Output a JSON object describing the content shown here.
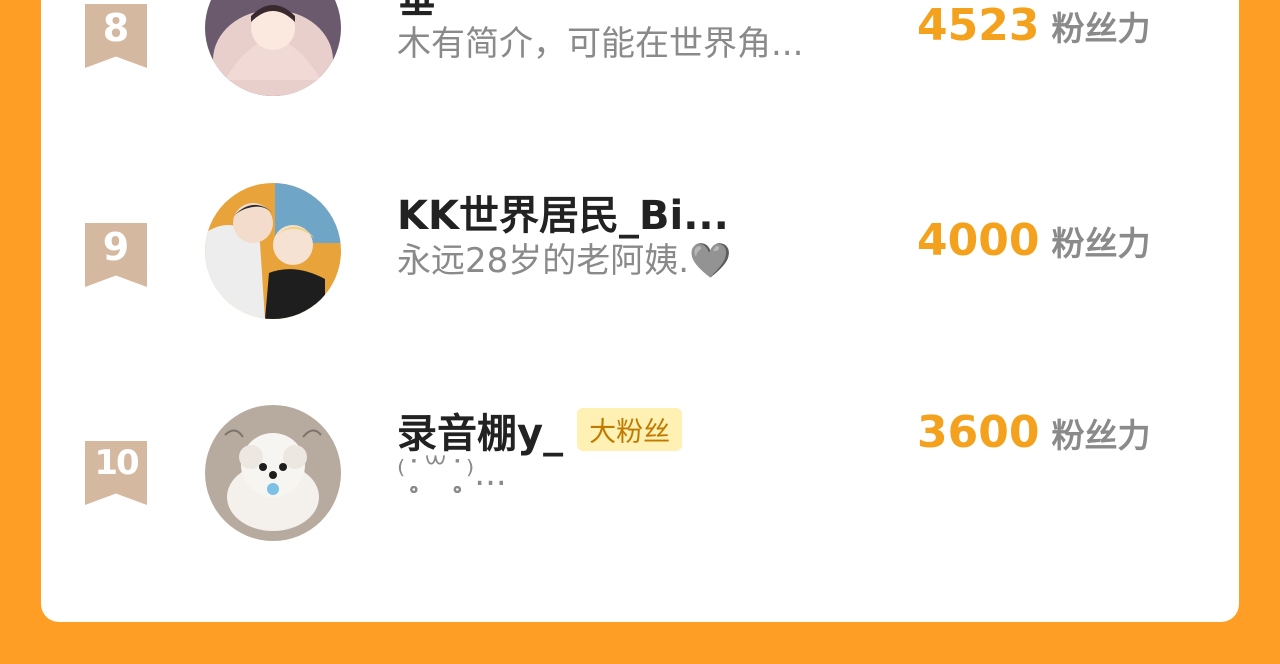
{
  "list": [
    {
      "rank": "8",
      "name": "垂一",
      "intro": "木有简介，可能在世界角...",
      "badge": "",
      "score": "4523",
      "unit": "粉丝力"
    },
    {
      "rank": "9",
      "name": "KK世界居民_Bi...",
      "intro": "永远28岁的老阿姨.🩶",
      "badge": "",
      "score": "4000",
      "unit": "粉丝力"
    },
    {
      "rank": "10",
      "name": "录音棚y_",
      "intro": "⁽˙̥̥̥̥̥̥̥̥꒳˙̥̥̥̥̥̥̥̥̥⁾...",
      "badge": "大粉丝",
      "score": "3600",
      "unit": "粉丝力"
    }
  ],
  "colors": {
    "background": "#FF9E25",
    "card": "#FFFFFF",
    "score": "#F4A21E",
    "rank_badge": "#D5B8A0",
    "fan_badge_bg": "#FFF0B3"
  }
}
